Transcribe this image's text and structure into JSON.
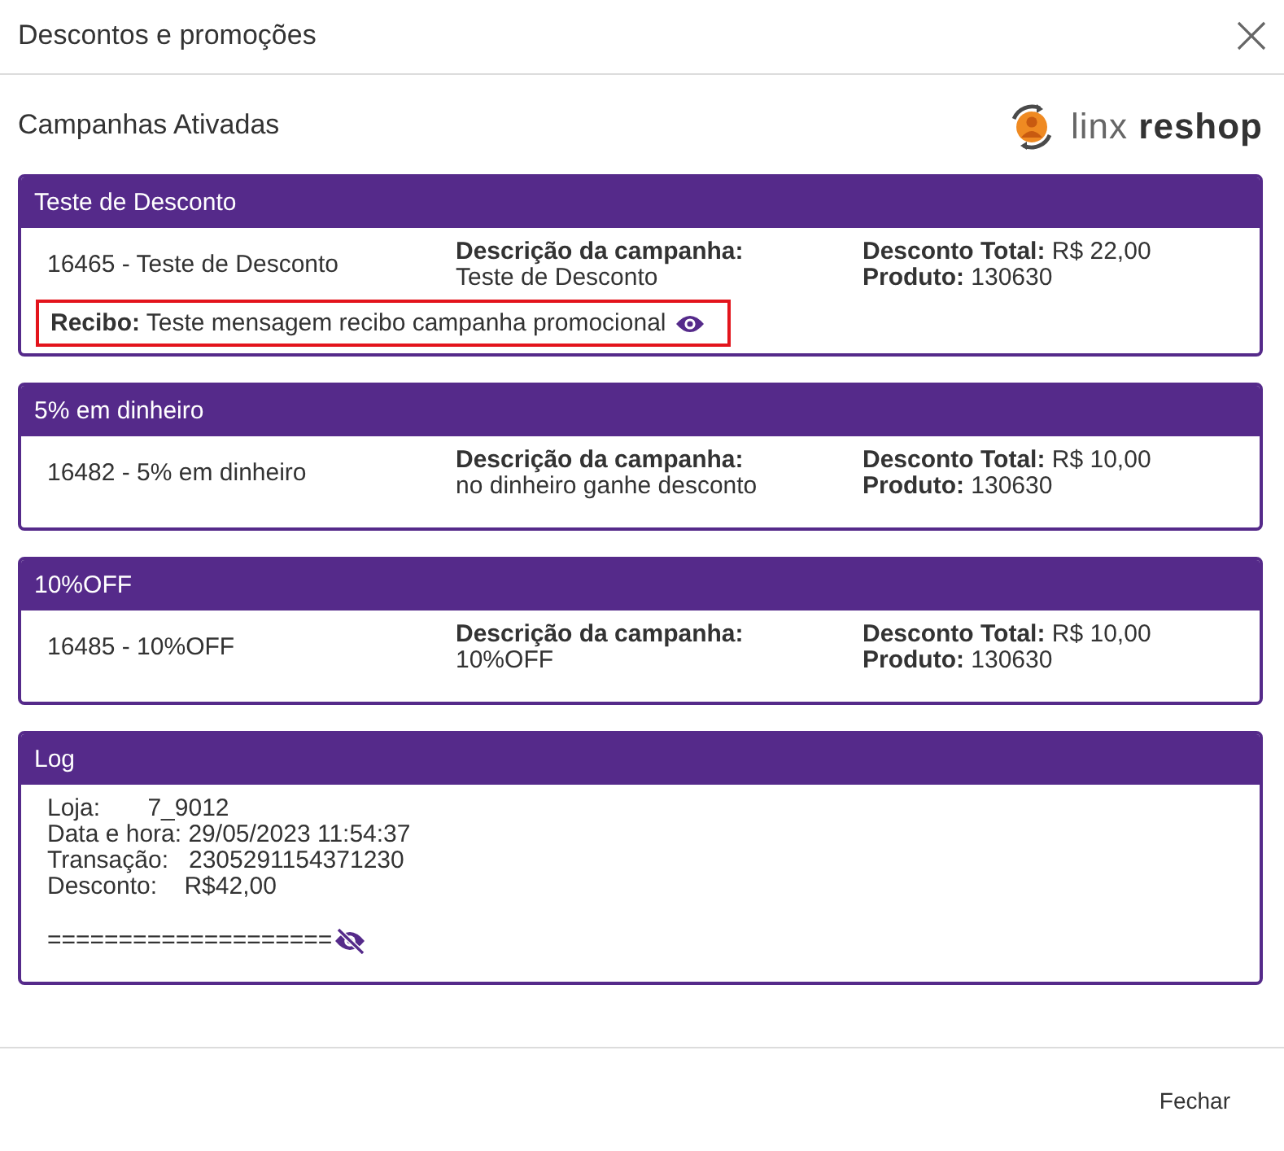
{
  "dialog": {
    "title": "Descontos e promoções"
  },
  "section_title": "Campanhas Ativadas",
  "logo": {
    "text": "linx **reshop**"
  },
  "campaigns": [
    {
      "title": "Teste de Desconto",
      "name": "16465 - Teste de Desconto",
      "description_label": "Descrição da campanha:",
      "description": "Teste de Desconto",
      "total": "**Desconto Total:** R$ 22,00",
      "product": "**Produto:** 130630",
      "receipt": {
        "text": "**Recibo:** Teste mensagem recibo campanha promocional",
        "highlighted": true
      }
    },
    {
      "title": "5% em dinheiro",
      "name": "16482 - 5% em dinheiro",
      "description_label": "Descrição da campanha:",
      "description": "no dinheiro ganhe desconto",
      "total": "**Desconto Total:** R$ 10,00",
      "product": "**Produto:** 130630"
    },
    {
      "title": "10%OFF",
      "name": "16485 - 10%OFF",
      "description_label": "Descrição da campanha:",
      "description": "10%OFF",
      "total": "**Desconto Total:** R$ 10,00",
      "product": "**Produto:** 130630"
    }
  ],
  "log": {
    "title": "Log",
    "lines": [
      "Loja:       7_9012",
      "Data e hora: 29/05/2023 11:54:37",
      "Transação:   2305291154371230",
      "Desconto:    R$42,00"
    ],
    "separator": "===================="
  },
  "buttons": [
    "Fechar"
  ]
}
